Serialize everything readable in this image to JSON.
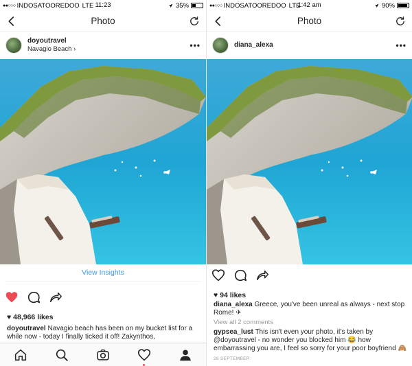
{
  "colors": {
    "accent": "#3897f0",
    "heart": "#ed4956",
    "text": "#262626",
    "muted": "#999999"
  },
  "left": {
    "status": {
      "signal": "●●○○○",
      "carrier": "INDOSATOOREDOO",
      "network": "LTE",
      "time": "11:23",
      "battery": "35%",
      "battery_level": 0.35
    },
    "nav": {
      "title": "Photo",
      "back_icon": "chevron-left-icon",
      "refresh_icon": "refresh-icon"
    },
    "post": {
      "username": "doyoutravel",
      "location": "Navagio Beach",
      "more_label": "•••",
      "insights_label": "View Insights",
      "liked": true,
      "likes": "48,966 likes",
      "caption_user": "doyoutravel",
      "caption_text": "Navagio beach has been on my bucket list for a while now - today I finally ticked it off! Zakynthos,"
    },
    "tabbar": {
      "items": [
        "home-icon",
        "search-icon",
        "camera-icon",
        "heart-icon",
        "profile-icon"
      ],
      "active": "profile-icon",
      "notify_dot_on": "heart-icon"
    }
  },
  "right": {
    "status": {
      "signal": "●●○○○",
      "carrier": "INDOSATOOREDOO",
      "network": "LTE",
      "time": "1:42 am",
      "battery": "90%",
      "battery_level": 0.9
    },
    "nav": {
      "title": "Photo",
      "back_icon": "chevron-left-icon",
      "refresh_icon": "refresh-icon"
    },
    "post": {
      "username": "diana_alexa",
      "more_label": "•••",
      "liked": false,
      "likes": "94 likes",
      "caption_user": "diana_alexa",
      "caption_text": "Greece, you've been unreal as always - next stop Rome! ✈",
      "view_all": "View all 2 comments",
      "comment_user": "gypsea_lust",
      "comment_text": "This isn't even your photo, it's taken by @doyoutravel - no wonder you blocked him 😂 how embarrassing you are, I feel so sorry for your poor boyfriend 🙈",
      "date": "26 SEPTEMBER"
    }
  }
}
